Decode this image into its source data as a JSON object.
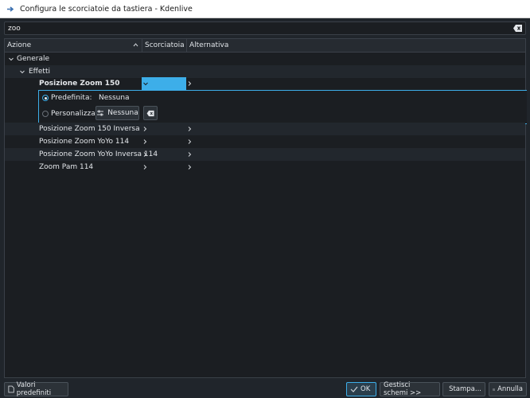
{
  "window": {
    "title": "Configura le scorciatoie da tastiera - Kdenlive"
  },
  "search": {
    "value": "zoo"
  },
  "table": {
    "columns": [
      "Azione",
      "Scorciatoia",
      "Alternativa"
    ],
    "group": "Generale",
    "subgroup": "Effetti",
    "selected_row": "Posizione Zoom 150",
    "rows": [
      "Posizione Zoom 150 Inversa",
      "Posizione Zoom YoYo 114",
      "Posizione Zoom YoYo Inversa 114",
      "Zoom Pam 114"
    ]
  },
  "detail": {
    "default_label": "Predefinita:",
    "default_value": "Nessuna",
    "custom_label": "Personalizzata:",
    "custom_button": "Nessuna"
  },
  "footer": {
    "defaults": "Valori predefiniti",
    "ok": "OK",
    "schemes": "Gestisci schemi >>",
    "print": "Stampa...",
    "cancel": "Annulla"
  },
  "colors": {
    "accent": "#3daee9",
    "background": "#1b1e22"
  }
}
